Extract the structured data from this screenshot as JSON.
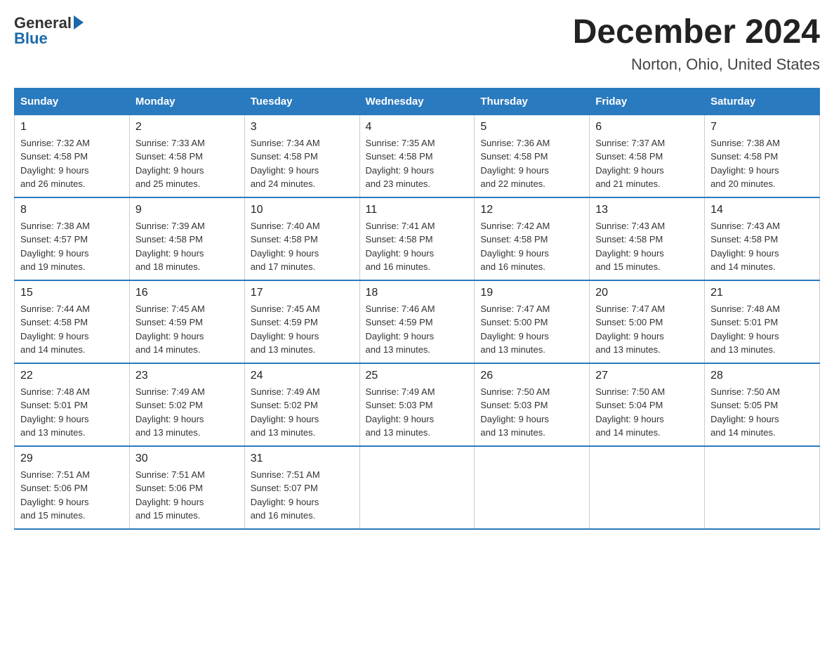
{
  "logo": {
    "general": "General",
    "blue": "Blue"
  },
  "header": {
    "month": "December 2024",
    "location": "Norton, Ohio, United States"
  },
  "days_of_week": [
    "Sunday",
    "Monday",
    "Tuesday",
    "Wednesday",
    "Thursday",
    "Friday",
    "Saturday"
  ],
  "weeks": [
    [
      {
        "day": "1",
        "sunrise": "7:32 AM",
        "sunset": "4:58 PM",
        "daylight": "9 hours and 26 minutes."
      },
      {
        "day": "2",
        "sunrise": "7:33 AM",
        "sunset": "4:58 PM",
        "daylight": "9 hours and 25 minutes."
      },
      {
        "day": "3",
        "sunrise": "7:34 AM",
        "sunset": "4:58 PM",
        "daylight": "9 hours and 24 minutes."
      },
      {
        "day": "4",
        "sunrise": "7:35 AM",
        "sunset": "4:58 PM",
        "daylight": "9 hours and 23 minutes."
      },
      {
        "day": "5",
        "sunrise": "7:36 AM",
        "sunset": "4:58 PM",
        "daylight": "9 hours and 22 minutes."
      },
      {
        "day": "6",
        "sunrise": "7:37 AM",
        "sunset": "4:58 PM",
        "daylight": "9 hours and 21 minutes."
      },
      {
        "day": "7",
        "sunrise": "7:38 AM",
        "sunset": "4:58 PM",
        "daylight": "9 hours and 20 minutes."
      }
    ],
    [
      {
        "day": "8",
        "sunrise": "7:38 AM",
        "sunset": "4:57 PM",
        "daylight": "9 hours and 19 minutes."
      },
      {
        "day": "9",
        "sunrise": "7:39 AM",
        "sunset": "4:58 PM",
        "daylight": "9 hours and 18 minutes."
      },
      {
        "day": "10",
        "sunrise": "7:40 AM",
        "sunset": "4:58 PM",
        "daylight": "9 hours and 17 minutes."
      },
      {
        "day": "11",
        "sunrise": "7:41 AM",
        "sunset": "4:58 PM",
        "daylight": "9 hours and 16 minutes."
      },
      {
        "day": "12",
        "sunrise": "7:42 AM",
        "sunset": "4:58 PM",
        "daylight": "9 hours and 16 minutes."
      },
      {
        "day": "13",
        "sunrise": "7:43 AM",
        "sunset": "4:58 PM",
        "daylight": "9 hours and 15 minutes."
      },
      {
        "day": "14",
        "sunrise": "7:43 AM",
        "sunset": "4:58 PM",
        "daylight": "9 hours and 14 minutes."
      }
    ],
    [
      {
        "day": "15",
        "sunrise": "7:44 AM",
        "sunset": "4:58 PM",
        "daylight": "9 hours and 14 minutes."
      },
      {
        "day": "16",
        "sunrise": "7:45 AM",
        "sunset": "4:59 PM",
        "daylight": "9 hours and 14 minutes."
      },
      {
        "day": "17",
        "sunrise": "7:45 AM",
        "sunset": "4:59 PM",
        "daylight": "9 hours and 13 minutes."
      },
      {
        "day": "18",
        "sunrise": "7:46 AM",
        "sunset": "4:59 PM",
        "daylight": "9 hours and 13 minutes."
      },
      {
        "day": "19",
        "sunrise": "7:47 AM",
        "sunset": "5:00 PM",
        "daylight": "9 hours and 13 minutes."
      },
      {
        "day": "20",
        "sunrise": "7:47 AM",
        "sunset": "5:00 PM",
        "daylight": "9 hours and 13 minutes."
      },
      {
        "day": "21",
        "sunrise": "7:48 AM",
        "sunset": "5:01 PM",
        "daylight": "9 hours and 13 minutes."
      }
    ],
    [
      {
        "day": "22",
        "sunrise": "7:48 AM",
        "sunset": "5:01 PM",
        "daylight": "9 hours and 13 minutes."
      },
      {
        "day": "23",
        "sunrise": "7:49 AM",
        "sunset": "5:02 PM",
        "daylight": "9 hours and 13 minutes."
      },
      {
        "day": "24",
        "sunrise": "7:49 AM",
        "sunset": "5:02 PM",
        "daylight": "9 hours and 13 minutes."
      },
      {
        "day": "25",
        "sunrise": "7:49 AM",
        "sunset": "5:03 PM",
        "daylight": "9 hours and 13 minutes."
      },
      {
        "day": "26",
        "sunrise": "7:50 AM",
        "sunset": "5:03 PM",
        "daylight": "9 hours and 13 minutes."
      },
      {
        "day": "27",
        "sunrise": "7:50 AM",
        "sunset": "5:04 PM",
        "daylight": "9 hours and 14 minutes."
      },
      {
        "day": "28",
        "sunrise": "7:50 AM",
        "sunset": "5:05 PM",
        "daylight": "9 hours and 14 minutes."
      }
    ],
    [
      {
        "day": "29",
        "sunrise": "7:51 AM",
        "sunset": "5:06 PM",
        "daylight": "9 hours and 15 minutes."
      },
      {
        "day": "30",
        "sunrise": "7:51 AM",
        "sunset": "5:06 PM",
        "daylight": "9 hours and 15 minutes."
      },
      {
        "day": "31",
        "sunrise": "7:51 AM",
        "sunset": "5:07 PM",
        "daylight": "9 hours and 16 minutes."
      },
      null,
      null,
      null,
      null
    ]
  ],
  "labels": {
    "sunrise": "Sunrise:",
    "sunset": "Sunset:",
    "daylight": "Daylight:"
  }
}
